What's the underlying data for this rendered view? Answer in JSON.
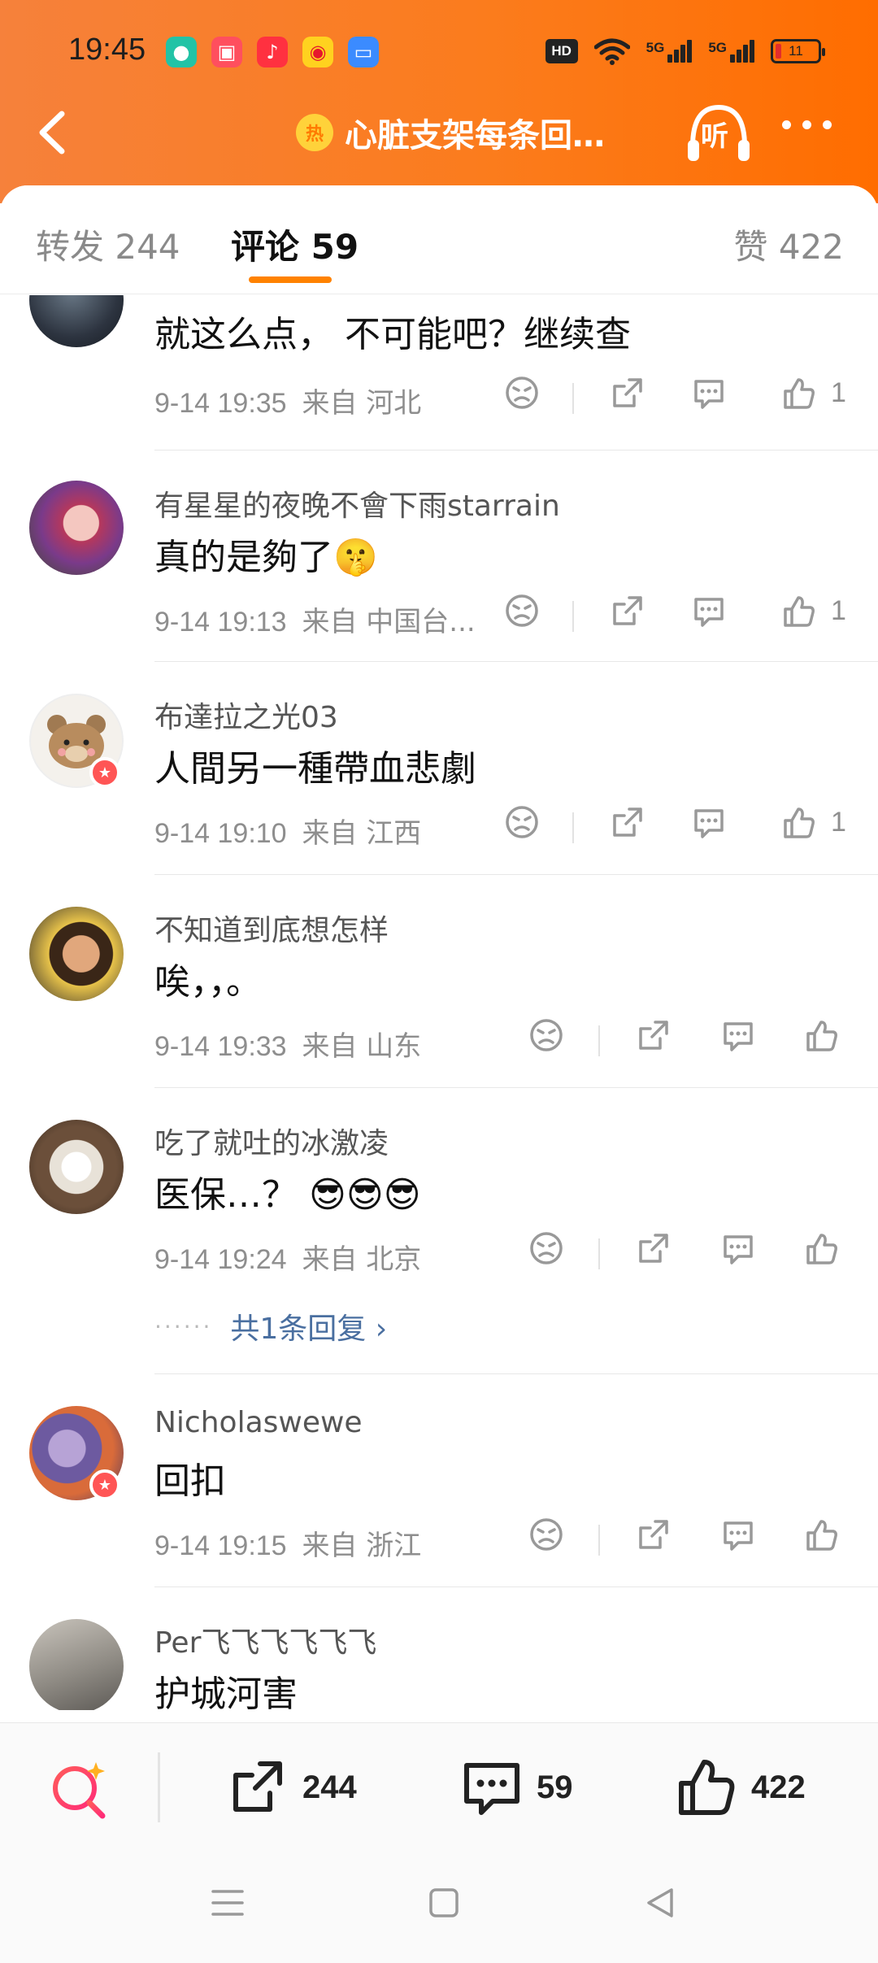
{
  "status_bar": {
    "time": "19:45",
    "app_icons": [
      "chat-app-icon",
      "community-app-icon",
      "music-app-icon",
      "weibo-app-icon",
      "files-app-icon"
    ],
    "hd_label": "HD",
    "signal_labels": [
      "5G",
      "5G"
    ],
    "battery": "11"
  },
  "header": {
    "hot_badge": "热",
    "title": "心脏支架每条回…",
    "listen_label": "听"
  },
  "tabs": {
    "repost": "转发 244",
    "comment": "评论 59",
    "like": "赞 422"
  },
  "comments": [
    {
      "username": "",
      "text": "就这么点，  不可能吧？继续查",
      "meta": "9-14 19:35",
      "location": "来自 河北",
      "likes": "1"
    },
    {
      "username": "有星星的夜晚不會下雨starrain",
      "text": "真的是夠了🤫",
      "meta": "9-14 19:13",
      "location": "来自 中国台...",
      "likes": "1"
    },
    {
      "username": "布達拉之光03",
      "text": "人間另一種帶血悲劇",
      "meta": "9-14 19:10",
      "location": "来自 江西",
      "likes": "1"
    },
    {
      "username": "不知道到底想怎样",
      "text": "唉，，。",
      "meta": "9-14 19:33",
      "location": "来自 山东",
      "likes": ""
    },
    {
      "username": "吃了就吐的冰激凌",
      "text": "医保…？ 😎😎😎",
      "meta": "9-14 19:24",
      "location": "来自 北京",
      "likes": "",
      "replies": "共1条回复 ›"
    },
    {
      "username": "Nicholaswewe",
      "text": "回扣",
      "meta": "9-14 19:15",
      "location": "来自 浙江",
      "likes": ""
    },
    {
      "username": "Per飞飞飞飞飞飞",
      "text": "护城河害",
      "meta": "",
      "location": "",
      "likes": ""
    }
  ],
  "bottom_bar": {
    "repost_count": "244",
    "comment_count": "59",
    "like_count": "422"
  },
  "colors": {
    "header_gradient_start": "#f6813b",
    "header_gradient_end": "#ff6d00",
    "tab_indicator": "#ff8200",
    "reply_link": "#4a6fa0"
  }
}
